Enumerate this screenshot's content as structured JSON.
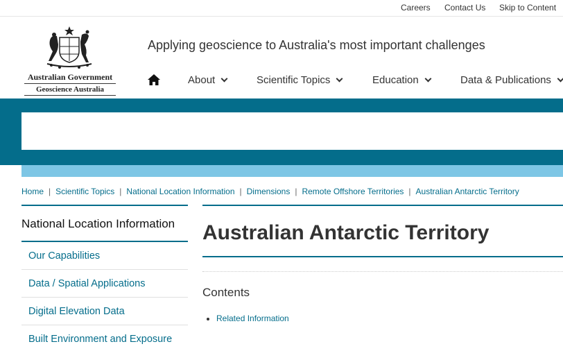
{
  "topbar": {
    "links": [
      "Careers",
      "Contact Us",
      "Skip to Content"
    ]
  },
  "logo": {
    "line1": "Australian Government",
    "line2": "Geoscience Australia"
  },
  "tagline": "Applying geoscience to Australia's most important challenges",
  "nav": {
    "home_icon": "home-icon",
    "items": [
      {
        "label": "About"
      },
      {
        "label": "Scientific Topics"
      },
      {
        "label": "Education"
      },
      {
        "label": "Data & Publications"
      }
    ]
  },
  "breadcrumb": [
    "Home",
    "Scientific Topics",
    "National Location Information",
    "Dimensions",
    "Remote Offshore Territories",
    "Australian Antarctic Territory"
  ],
  "sidebar": {
    "title": "National Location Information",
    "items": [
      "Our Capabilities",
      "Data / Spatial Applications",
      "Digital Elevation Data",
      "Built Environment and Exposure"
    ]
  },
  "main": {
    "title": "Australian Antarctic Territory",
    "contents_label": "Contents",
    "contents_items": [
      "Related Information"
    ]
  },
  "colors": {
    "primary_teal": "#046d8b",
    "light_blue": "#7dc6e5"
  }
}
